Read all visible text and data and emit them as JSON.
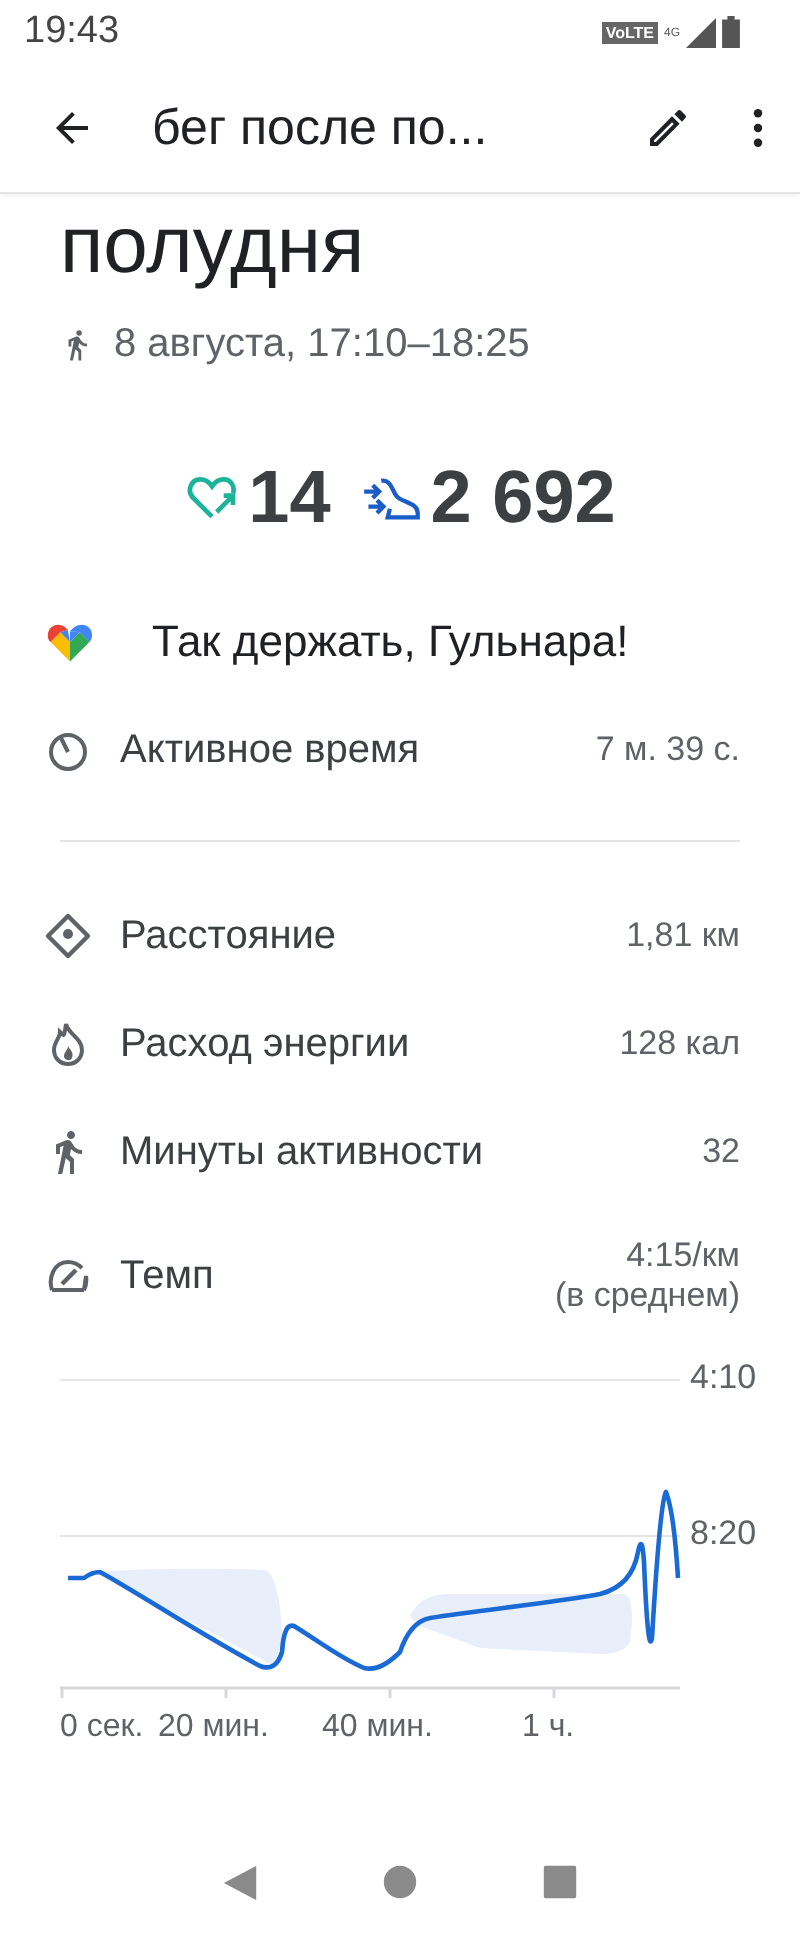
{
  "status_bar": {
    "time": "19:43",
    "network_badge": "VoLTE",
    "network_type": "4G"
  },
  "app_bar": {
    "title": "бег после по..."
  },
  "heading": "полудня",
  "date": "8 августа, 17:10–18:25",
  "highlights": [
    {
      "kind": "heart_points",
      "value": "14"
    },
    {
      "kind": "steps",
      "value": "2 692"
    }
  ],
  "message": "Так держать, Гульнара!",
  "active_time": {
    "label": "Активное время",
    "value": "7 м. 39 с."
  },
  "metrics": [
    {
      "kind": "distance",
      "label": "Расстояние",
      "value": "1,81 км"
    },
    {
      "kind": "energy",
      "label": "Расход энергии",
      "value": "128 кал"
    },
    {
      "kind": "move_minutes",
      "label": "Минуты активности",
      "value": "32"
    },
    {
      "kind": "pace",
      "label": "Темп",
      "value": "4:15/км",
      "note": "(в среднем)"
    }
  ],
  "pace_chart": {
    "y_labels": [
      "4:10",
      "8:20"
    ],
    "x_labels": [
      "0 сек.",
      "20 мин.",
      "40 мин.",
      "1 ч."
    ]
  }
}
